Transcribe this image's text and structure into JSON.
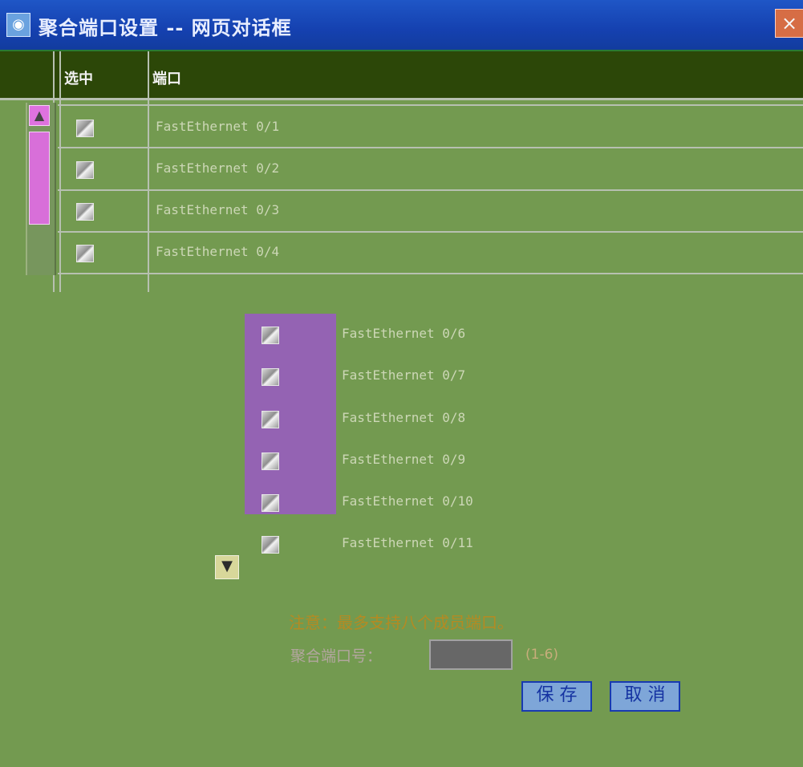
{
  "window": {
    "title": "聚合端口设置 -- 网页对话框"
  },
  "table": {
    "columns": [
      "选中",
      "端口"
    ],
    "rows_top": [
      "FastEthernet 0/1",
      "FastEthernet 0/2",
      "FastEthernet 0/3",
      "FastEthernet 0/4"
    ],
    "rows_bottom": [
      "FastEthernet 0/6",
      "FastEthernet 0/7",
      "FastEthernet 0/8",
      "FastEthernet 0/9",
      "FastEthernet 0/10",
      "FastEthernet 0/11"
    ]
  },
  "form": {
    "hint": "注意：最多支持八个成员端口。",
    "agg_label": "聚合端口号：",
    "agg_value": "",
    "range": "(1-6)",
    "save": "保 存",
    "cancel": "取 消"
  },
  "icons": {
    "window": "ie-window-icon",
    "close": "close-icon",
    "up": "scroll-up-icon",
    "down": "scroll-down-icon",
    "checkbox": "checkbox-icon"
  }
}
